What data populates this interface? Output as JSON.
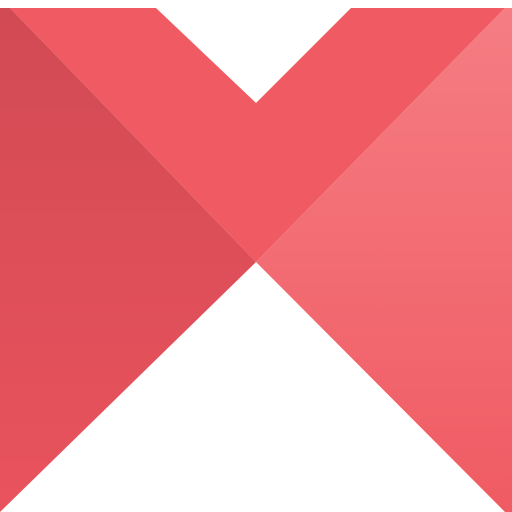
{
  "logo": {
    "icon_name": "m-logo-icon",
    "background_color": "#ffffff",
    "colors": {
      "top_band": "#f05b63",
      "left_panel": "#d24a54",
      "left_panel_bottom": "#e9535d",
      "right_panel_top": "#f57d83",
      "right_panel_bottom": "#f05b63"
    }
  }
}
